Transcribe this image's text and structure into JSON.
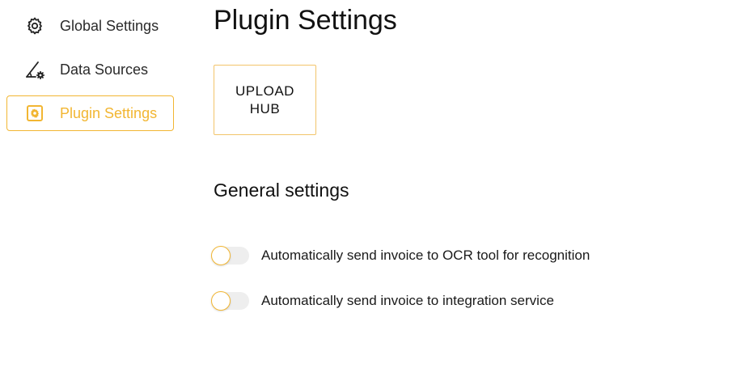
{
  "sidebar": {
    "items": [
      {
        "label": "Global Settings",
        "icon": "gear-icon",
        "active": false
      },
      {
        "label": "Data Sources",
        "icon": "data-sources-icon",
        "active": false
      },
      {
        "label": "Plugin Settings",
        "icon": "plugin-gear-icon",
        "active": true
      }
    ]
  },
  "main": {
    "title": "Plugin Settings",
    "upload_button": {
      "line1": "UPLOAD",
      "line2": "HUB"
    },
    "section_title": "General settings",
    "settings": [
      {
        "label": "Automatically send invoice to OCR tool for recognition",
        "enabled": false
      },
      {
        "label": "Automatically send invoice to integration service",
        "enabled": false
      }
    ]
  },
  "colors": {
    "accent": "#f2b632",
    "text": "#1a1a1a",
    "toggle_track": "#eeeeee"
  }
}
